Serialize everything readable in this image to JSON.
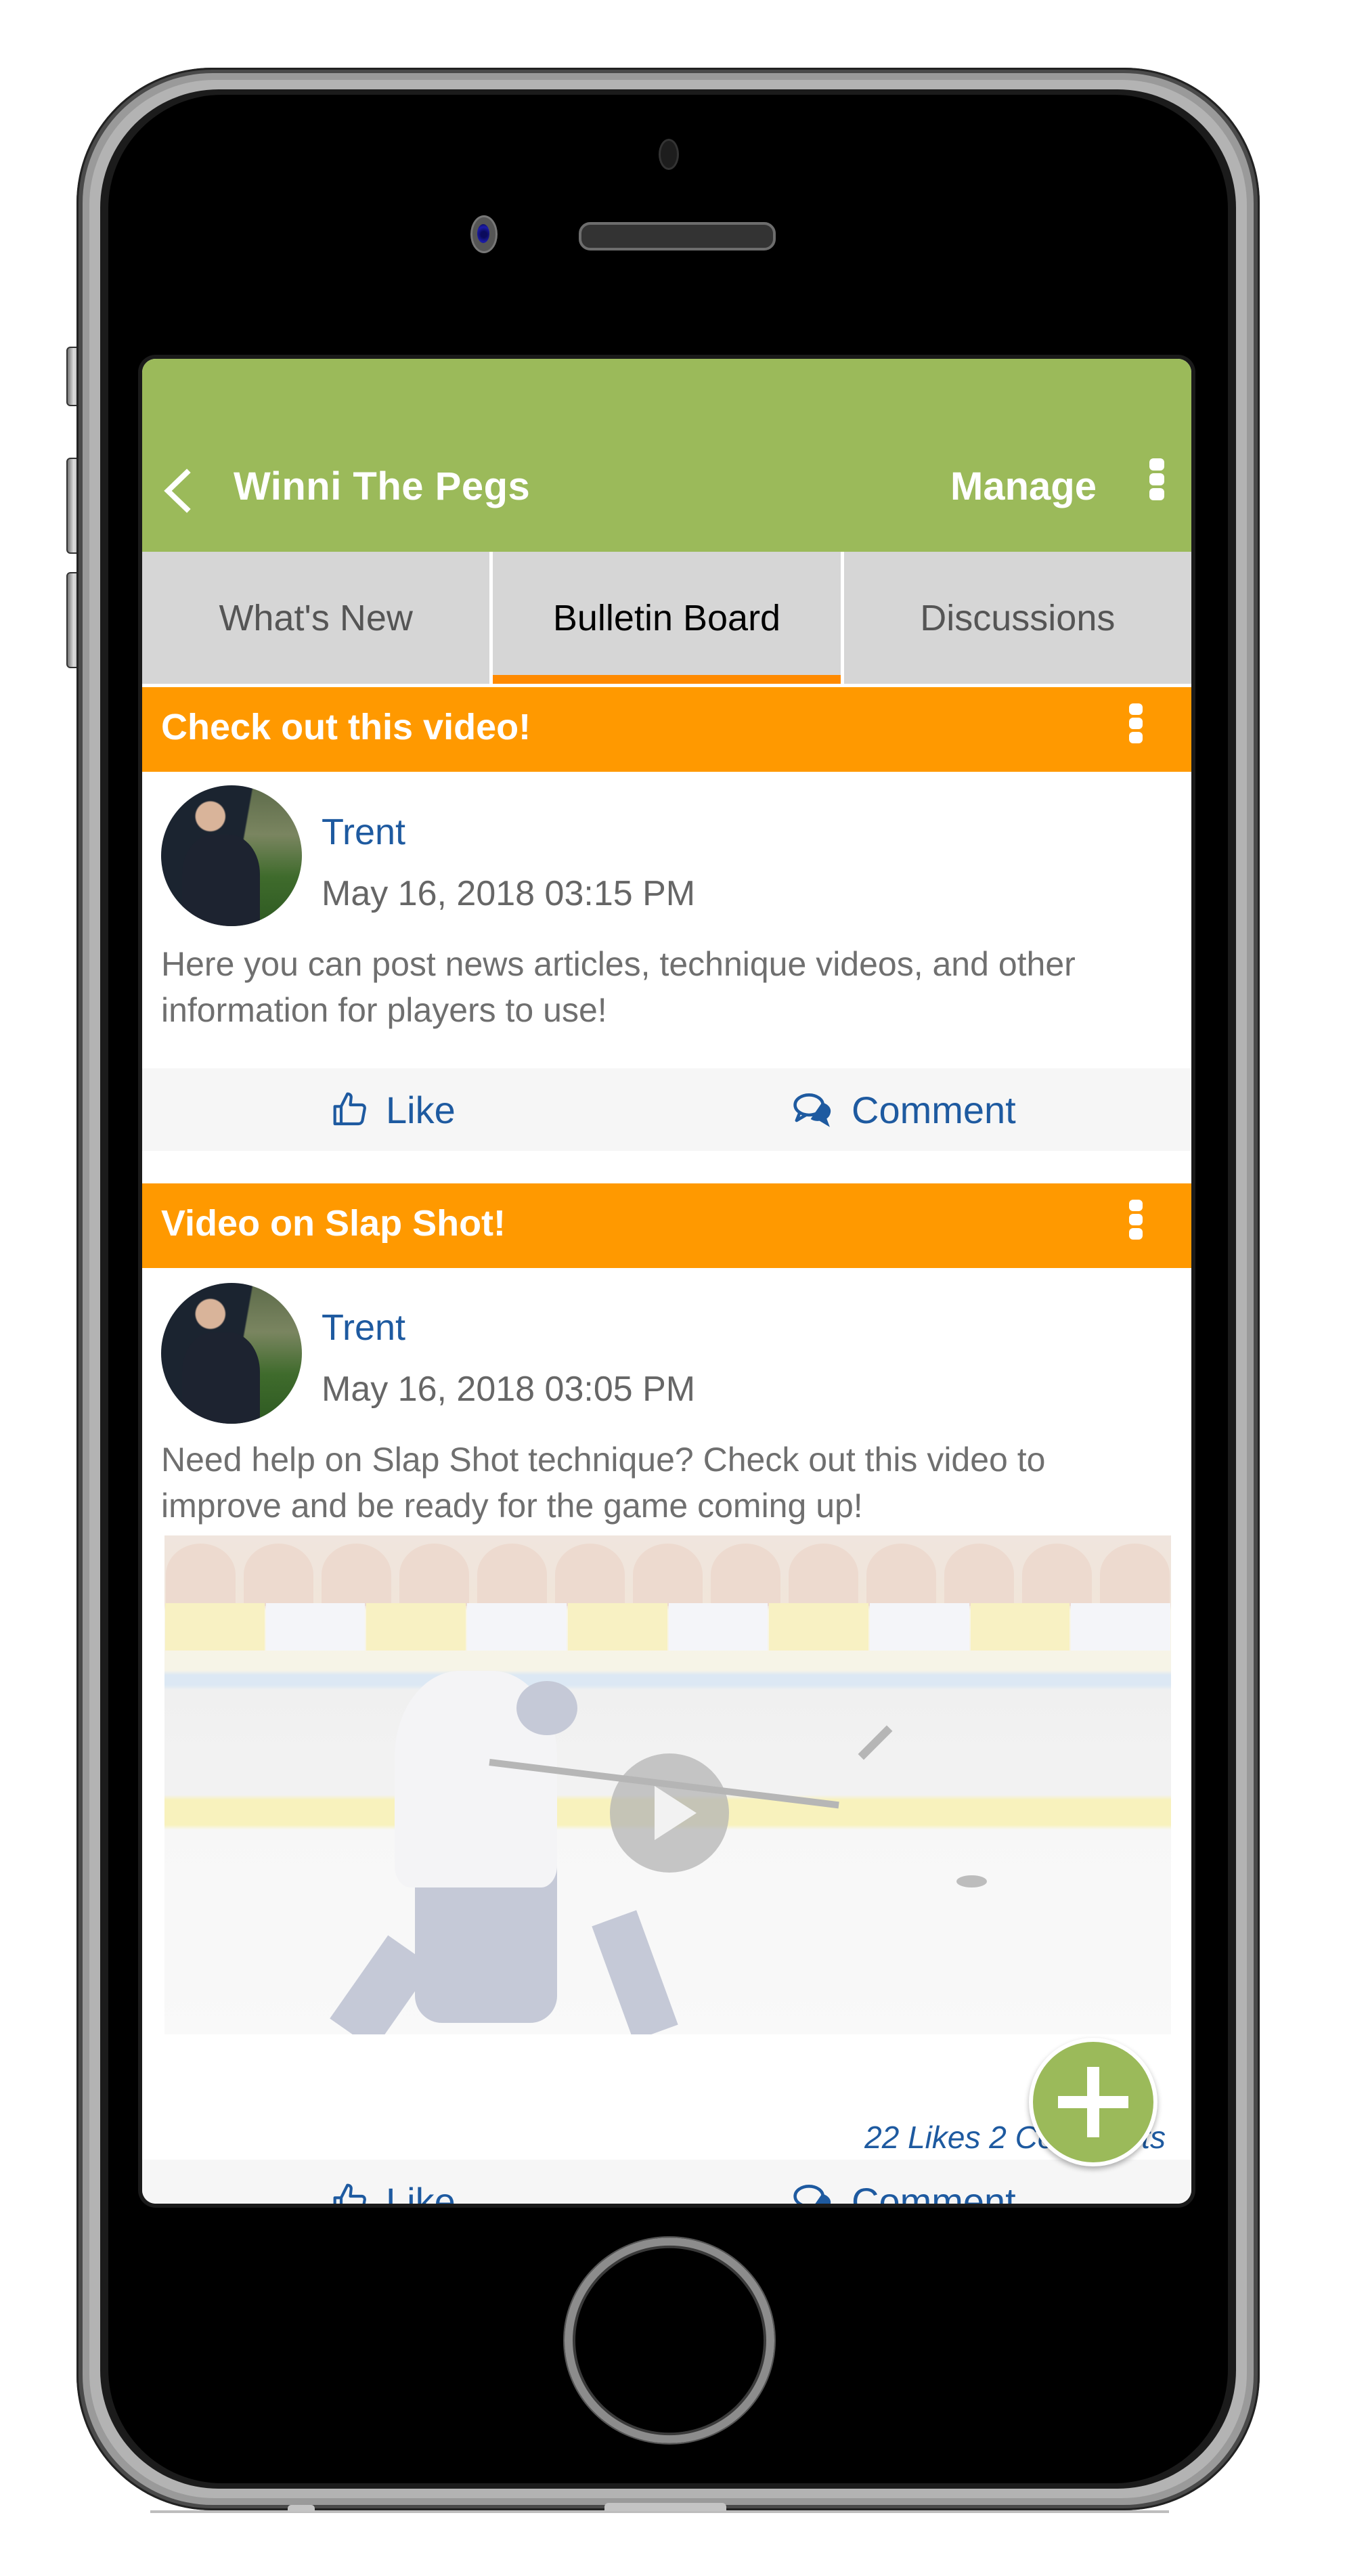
{
  "header": {
    "title": "Winni The Pegs",
    "manage_label": "Manage",
    "back_icon": "chevron-left-icon",
    "menu_icon": "more-vertical-icon",
    "color": "#9BBA5A"
  },
  "tabs": [
    {
      "label": "What's New",
      "active": false
    },
    {
      "label": "Bulletin Board",
      "active": true
    },
    {
      "label": "Discussions",
      "active": false
    }
  ],
  "posts": [
    {
      "title": "Check out this video!",
      "author": "Trent",
      "date": "May 16, 2018 03:15 PM",
      "body": "Here you can post news articles, technique videos, and other information for players to use!",
      "actions": {
        "like_label": "Like",
        "comment_label": "Comment"
      }
    },
    {
      "title": "Video on Slap Shot!",
      "author": "Trent",
      "date": "May 16, 2018 03:05 PM",
      "body": "Need help on Slap Shot technique? Check out this video to improve and be ready for the game coming up!",
      "media": {
        "type": "video",
        "description": "Hockey player taking a slap shot on ice",
        "play_icon": "play-icon"
      },
      "stats": "22 Likes 2 Comments",
      "actions": {
        "like_label": "Like",
        "comment_label": "Comment"
      }
    }
  ],
  "fab": {
    "icon": "plus-icon",
    "label": "Add post"
  },
  "colors": {
    "accent_green": "#9BBA5A",
    "post_bar_orange": "#FF9900",
    "active_tab_underline": "#FF8A00",
    "link_blue": "#1E5AA0",
    "tab_bg": "#D6D6D6"
  }
}
